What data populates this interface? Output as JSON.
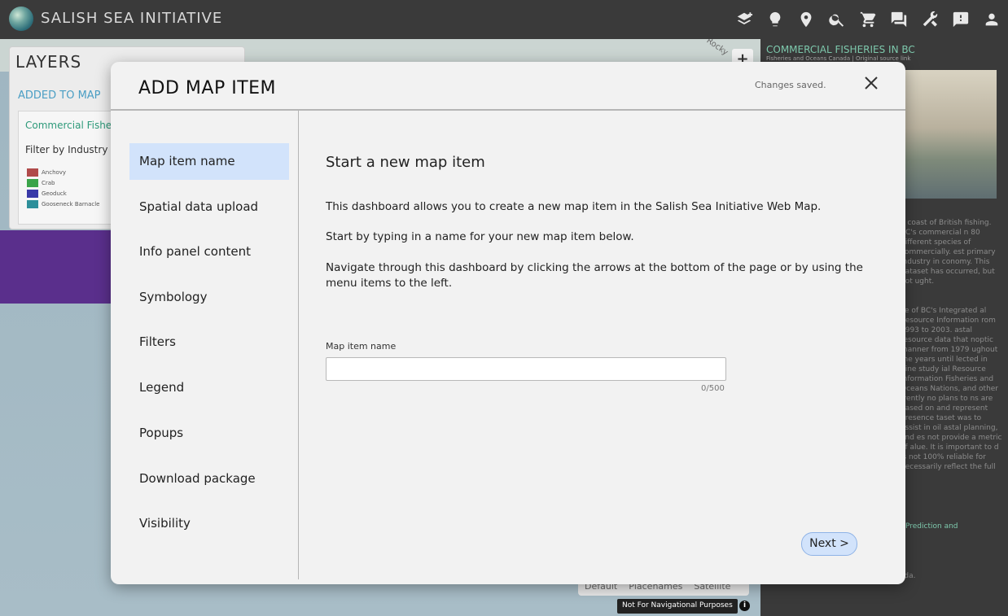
{
  "app": {
    "title": "SALISH SEA INITIATIVE"
  },
  "topbar_icons": [
    "add-layer-icon",
    "lightbulb-icon",
    "location-pin-icon",
    "search-icon",
    "cart-icon",
    "chat-icon",
    "tools-icon",
    "feedback-icon",
    "user-icon"
  ],
  "map": {
    "rocky_label": "Rocky",
    "zoom_in": "+",
    "basemap_options": [
      "Default",
      "Placenames",
      "Satellite"
    ],
    "nav_badge": "Not For Navigational Purposes",
    "info_glyph": "i"
  },
  "layers_panel": {
    "title": "LAYERS",
    "added_heading": "ADDED TO MAP",
    "card_title": "Commercial Fisheries",
    "filter_label": "Filter by Industry",
    "legend": [
      {
        "label": "Anchovy",
        "color": "#b04a4a"
      },
      {
        "label": "Crab",
        "color": "#3aa34a"
      },
      {
        "label": "Geoduck",
        "color": "#3a3aa8"
      },
      {
        "label": "Gooseneck Barnacle",
        "color": "#2e8f9a"
      }
    ]
  },
  "info_panel": {
    "title": "COMMERCIAL FISHERIES IN BC",
    "subtitle": "Fisheries and Oceans Canada | Original source link",
    "text_block_1": "e coast of British fishing. BC's commercial n 80 different species of commercially. est primary industry in conomy. This dataset has occurred, but not ught.",
    "text_block_2": "ce of BC's Integrated al Resource Information rom 1993 to 2003. astal resource data that noptic manner from 1979 ughout the years until lected in nine study ial Resource Information Fisheries and Oceans Nations, and other rrently no plans to ns are based on and represent presence taset was to assist in oil astal planning, and es not provide a metric of alue. It is important to d is not 100% reliable for necessarily reflect the full",
    "link_text": "Prediction and",
    "license_text": "the Open Government License - Canada."
  },
  "modal": {
    "title": "ADD MAP ITEM",
    "status": "Changes saved.",
    "menu": [
      {
        "label": "Map item name",
        "active": true
      },
      {
        "label": "Spatial data upload",
        "active": false
      },
      {
        "label": "Info panel content",
        "active": false
      },
      {
        "label": "Symbology",
        "active": false
      },
      {
        "label": "Filters",
        "active": false
      },
      {
        "label": "Legend",
        "active": false
      },
      {
        "label": "Popups",
        "active": false
      },
      {
        "label": "Download package",
        "active": false
      },
      {
        "label": "Visibility",
        "active": false
      }
    ],
    "section_title": "Start a new map item",
    "paragraphs": [
      "This dashboard allows you to create a new map item in the Salish Sea Initiative Web Map.",
      "Start by typing in a name for your new map item below.",
      "Navigate through this dashboard by clicking the arrows at the bottom of the page or by using the menu items to the left."
    ],
    "field": {
      "label": "Map item name",
      "value": "",
      "counter": "0/500"
    },
    "next_label": "Next >"
  }
}
